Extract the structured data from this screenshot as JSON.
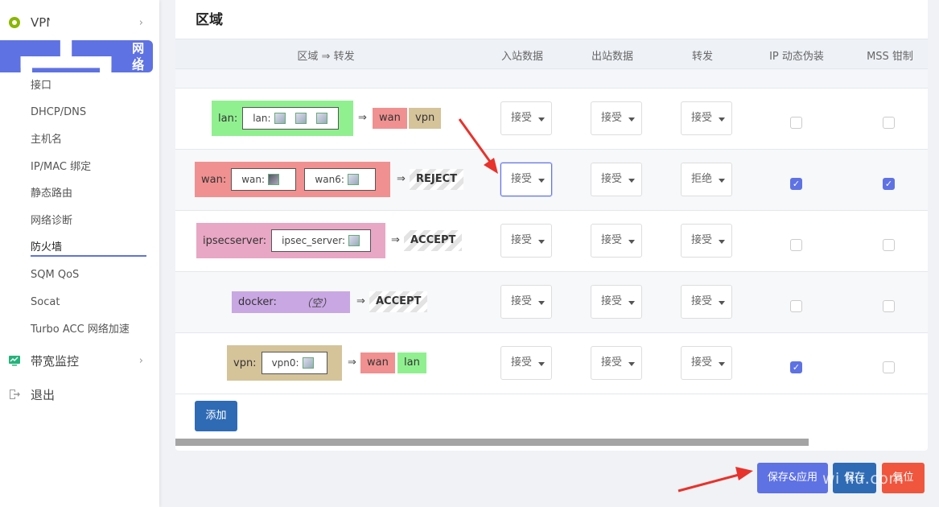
{
  "sidebar": {
    "vpn": "VPN",
    "network": "网络",
    "sub_items": [
      "接口",
      "DHCP/DNS",
      "主机名",
      "IP/MAC 绑定",
      "静态路由",
      "网络诊断",
      "防火墙",
      "SQM QoS",
      "Socat",
      "Turbo ACC 网络加速"
    ],
    "bandwidth": "带宽监控",
    "logout": "退出"
  },
  "panel": {
    "title": "区域",
    "headers": {
      "zone": "区域 ⇒ 转发",
      "input": "入站数据",
      "output": "出站数据",
      "forward": "转发",
      "masq": "IP 动态伪装",
      "mss": "MSS 钳制"
    },
    "arrow": "⇒",
    "accept": "接受",
    "reject_opt": "拒绝",
    "add_button": "添加"
  },
  "rows": [
    {
      "zone": "lan:",
      "ifaces": [
        "lan:"
      ],
      "targets": [
        "wan",
        "vpn"
      ],
      "masq": false,
      "mss": false
    },
    {
      "zone": "wan:",
      "ifaces": [
        "wan:",
        "wan6:"
      ],
      "target": "REJECT",
      "masq": true,
      "mss": true
    },
    {
      "zone": "ipsecserver:",
      "ifaces": [
        "ipsec_server:"
      ],
      "target": "ACCEPT",
      "masq": false,
      "mss": false
    },
    {
      "zone": "docker:",
      "empty": "（空）",
      "target": "ACCEPT",
      "masq": false,
      "mss": false
    },
    {
      "zone": "vpn:",
      "ifaces": [
        "vpn0:"
      ],
      "targets": [
        "wan",
        "lan"
      ],
      "masq": true,
      "mss": false
    }
  ],
  "footer": {
    "save_apply": "保存&应用",
    "save": "保存",
    "reset": "复位"
  },
  "watermark": "wi Iiu.com",
  "colors": {
    "accent": "#5e72e4",
    "lan_zone": "#90f090",
    "wan_zone": "#f09090",
    "ipsec_zone": "#e8a7c4",
    "docker_zone": "#c9a7e3",
    "vpn_zone": "#d5c39a",
    "annotation_arrow": "#e8322c"
  }
}
